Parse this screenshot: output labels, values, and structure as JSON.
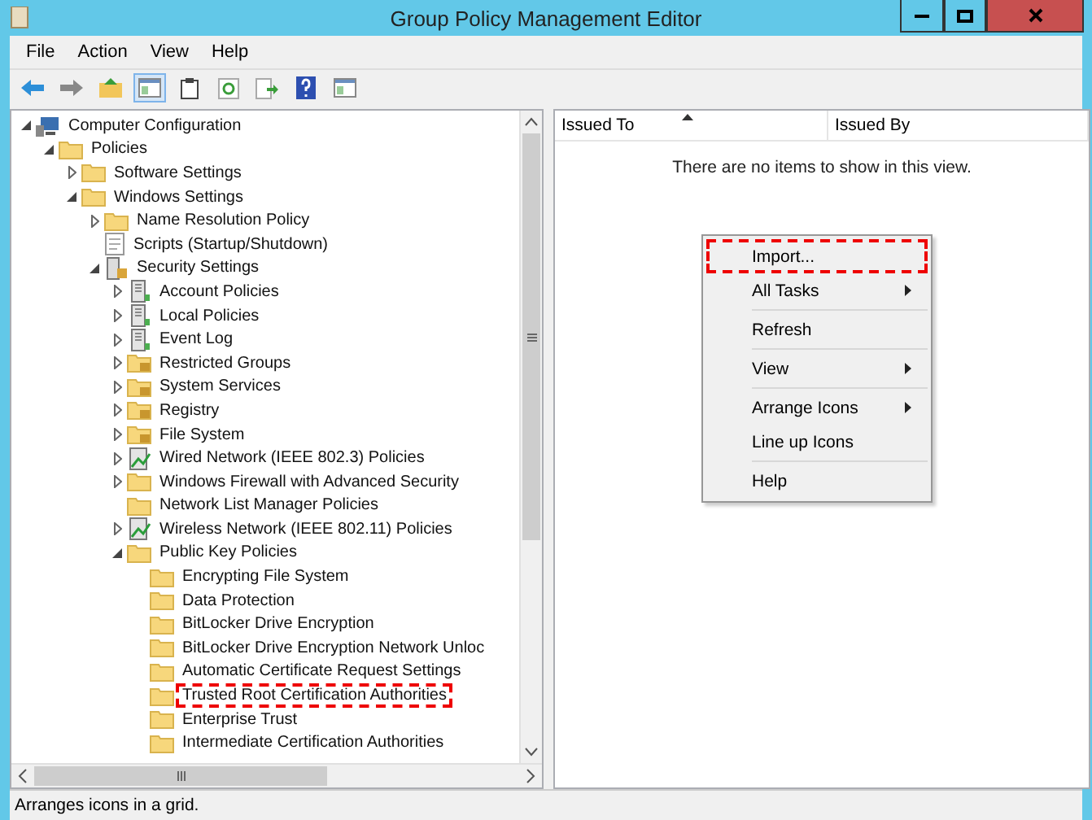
{
  "window": {
    "title": "Group Policy Management Editor"
  },
  "menu_bar": [
    "File",
    "Action",
    "View",
    "Help"
  ],
  "toolbar": [
    {
      "kind": "back"
    },
    {
      "kind": "forward"
    },
    {
      "kind": "up"
    },
    {
      "kind": "pane",
      "selected": true
    },
    {
      "kind": "clipboard"
    },
    {
      "kind": "refresh"
    },
    {
      "kind": "export"
    },
    {
      "kind": "help"
    },
    {
      "kind": "pane",
      "selected": false
    }
  ],
  "tree": [
    {
      "label": "Computer Configuration",
      "kind": "computer",
      "expanded": true,
      "highlighted": false,
      "children": [
        {
          "label": "Policies",
          "kind": "folder",
          "expanded": true,
          "highlighted": false,
          "children": [
            {
              "label": "Software Settings",
              "kind": "folder",
              "expanded": false,
              "highlighted": false
            },
            {
              "label": "Windows Settings",
              "kind": "folder",
              "expanded": true,
              "highlighted": false,
              "children": [
                {
                  "label": "Name Resolution Policy",
                  "kind": "folder",
                  "expanded": false,
                  "highlighted": false
                },
                {
                  "label": "Scripts (Startup/Shutdown)",
                  "kind": "script",
                  "highlighted": false
                },
                {
                  "label": "Security Settings",
                  "kind": "security",
                  "expanded": true,
                  "highlighted": false,
                  "children": [
                    {
                      "label": "Account Policies",
                      "kind": "policy",
                      "expanded": false,
                      "highlighted": false
                    },
                    {
                      "label": "Local Policies",
                      "kind": "policy",
                      "expanded": false,
                      "highlighted": false
                    },
                    {
                      "label": "Event Log",
                      "kind": "policy",
                      "expanded": false,
                      "highlighted": false
                    },
                    {
                      "label": "Restricted Groups",
                      "kind": "locked",
                      "expanded": false,
                      "highlighted": false
                    },
                    {
                      "label": "System Services",
                      "kind": "locked",
                      "expanded": false,
                      "highlighted": false
                    },
                    {
                      "label": "Registry",
                      "kind": "locked",
                      "expanded": false,
                      "highlighted": false
                    },
                    {
                      "label": "File System",
                      "kind": "locked",
                      "expanded": false,
                      "highlighted": false
                    },
                    {
                      "label": "Wired Network (IEEE 802.3) Policies",
                      "kind": "network",
                      "expanded": false,
                      "highlighted": false
                    },
                    {
                      "label": "Windows Firewall with Advanced Security",
                      "kind": "folder",
                      "expanded": false,
                      "highlighted": false
                    },
                    {
                      "label": "Network List Manager Policies",
                      "kind": "folder",
                      "highlighted": false
                    },
                    {
                      "label": "Wireless Network (IEEE 802.11) Policies",
                      "kind": "network",
                      "expanded": false,
                      "highlighted": false
                    },
                    {
                      "label": "Public Key Policies",
                      "kind": "folder",
                      "expanded": true,
                      "highlighted": false,
                      "children": [
                        {
                          "label": "Encrypting File System",
                          "kind": "folder",
                          "highlighted": false
                        },
                        {
                          "label": "Data Protection",
                          "kind": "folder",
                          "highlighted": false
                        },
                        {
                          "label": "BitLocker Drive Encryption",
                          "kind": "folder",
                          "highlighted": false
                        },
                        {
                          "label": "BitLocker Drive Encryption Network Unloc",
                          "kind": "folder",
                          "highlighted": false
                        },
                        {
                          "label": "Automatic Certificate Request Settings",
                          "kind": "folder",
                          "highlighted": false
                        },
                        {
                          "label": "Trusted Root Certification Authorities",
                          "kind": "folder",
                          "highlighted": true
                        },
                        {
                          "label": "Enterprise Trust",
                          "kind": "folder",
                          "highlighted": false
                        },
                        {
                          "label": "Intermediate Certification Authorities",
                          "kind": "folder",
                          "highlighted": false
                        }
                      ]
                    }
                  ]
                }
              ]
            }
          ]
        }
      ]
    }
  ],
  "columns": [
    {
      "label": "Issued To",
      "sorted": true
    },
    {
      "label": "Issued By",
      "sorted": false
    }
  ],
  "empty_message": "There are no items to show in this view.",
  "context_menu": [
    [
      {
        "label": "Import...",
        "submenu": false,
        "highlighted": true
      },
      {
        "label": "All Tasks",
        "submenu": true,
        "highlighted": false
      }
    ],
    [
      {
        "label": "Refresh",
        "submenu": false,
        "highlighted": false
      }
    ],
    [
      {
        "label": "View",
        "submenu": true,
        "highlighted": false
      }
    ],
    [
      {
        "label": "Arrange Icons",
        "submenu": true,
        "highlighted": false
      },
      {
        "label": "Line up Icons",
        "submenu": false,
        "highlighted": false
      }
    ],
    [
      {
        "label": "Help",
        "submenu": false,
        "highlighted": false
      }
    ]
  ],
  "status_bar": "Arranges icons in a grid."
}
